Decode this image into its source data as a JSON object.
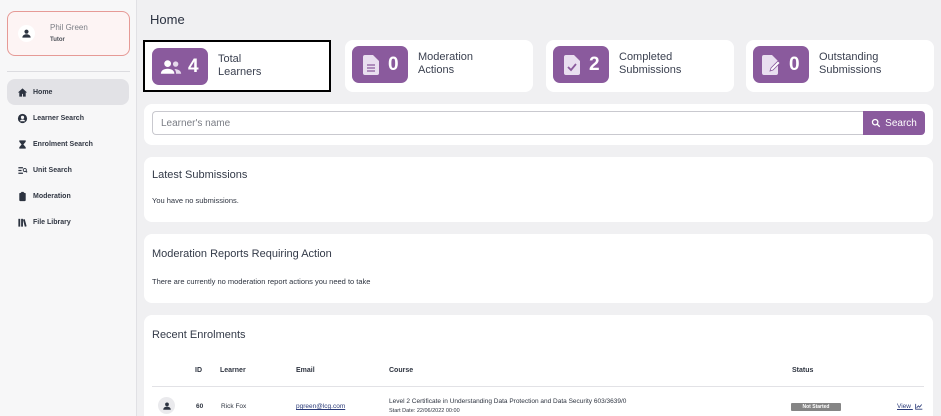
{
  "user": {
    "name": "Phil Green",
    "role": "Tutor",
    "icon": "person-icon"
  },
  "nav": [
    {
      "label": "Home",
      "icon": "home-icon",
      "active": true
    },
    {
      "label": "Learner Search",
      "icon": "account-circle-icon"
    },
    {
      "label": "Enrolment Search",
      "icon": "enrolment-icon"
    },
    {
      "label": "Unit Search",
      "icon": "unit-search-icon"
    },
    {
      "label": "Moderation",
      "icon": "clipboard-icon"
    },
    {
      "label": "File Library",
      "icon": "library-icon"
    }
  ],
  "page_title": "Home",
  "stats": [
    {
      "value": "4",
      "label1": "Total",
      "label2": "Learners",
      "icon": "people-icon"
    },
    {
      "value": "0",
      "label1": "Moderation",
      "label2": "Actions",
      "icon": "document-icon"
    },
    {
      "value": "2",
      "label1": "Completed",
      "label2": "Submissions",
      "icon": "check-document-icon"
    },
    {
      "value": "0",
      "label1": "Outstanding",
      "label2": "Submissions",
      "icon": "edit-document-icon"
    }
  ],
  "search": {
    "placeholder": "Learner's name",
    "button_label": "Search"
  },
  "latest_submissions": {
    "title": "Latest Submissions",
    "empty_text": "You have no submissions."
  },
  "moderation_reports": {
    "title": "Moderation Reports Requiring Action",
    "empty_text": "There are currently no moderation report actions you need to take"
  },
  "recent_enrolments": {
    "title": "Recent Enrolments",
    "headers": {
      "id": "ID",
      "learner": "Learner",
      "email": "Email",
      "course": "Course",
      "status": "Status"
    },
    "rows": [
      {
        "id": "60",
        "learner": "Rick Fox",
        "email": "pgreen@lcg.com",
        "course": "Level 2 Certificate in Understanding Data Protection and Data Security 603/3639/0",
        "start_date": "Start Date: 22/06/2022 00:00",
        "status": "Not Started",
        "view_label": "View"
      }
    ]
  },
  "colors": {
    "accent": "#8a5a9d",
    "background": "#f0f0f2",
    "user_card_border": "#e69a96"
  }
}
